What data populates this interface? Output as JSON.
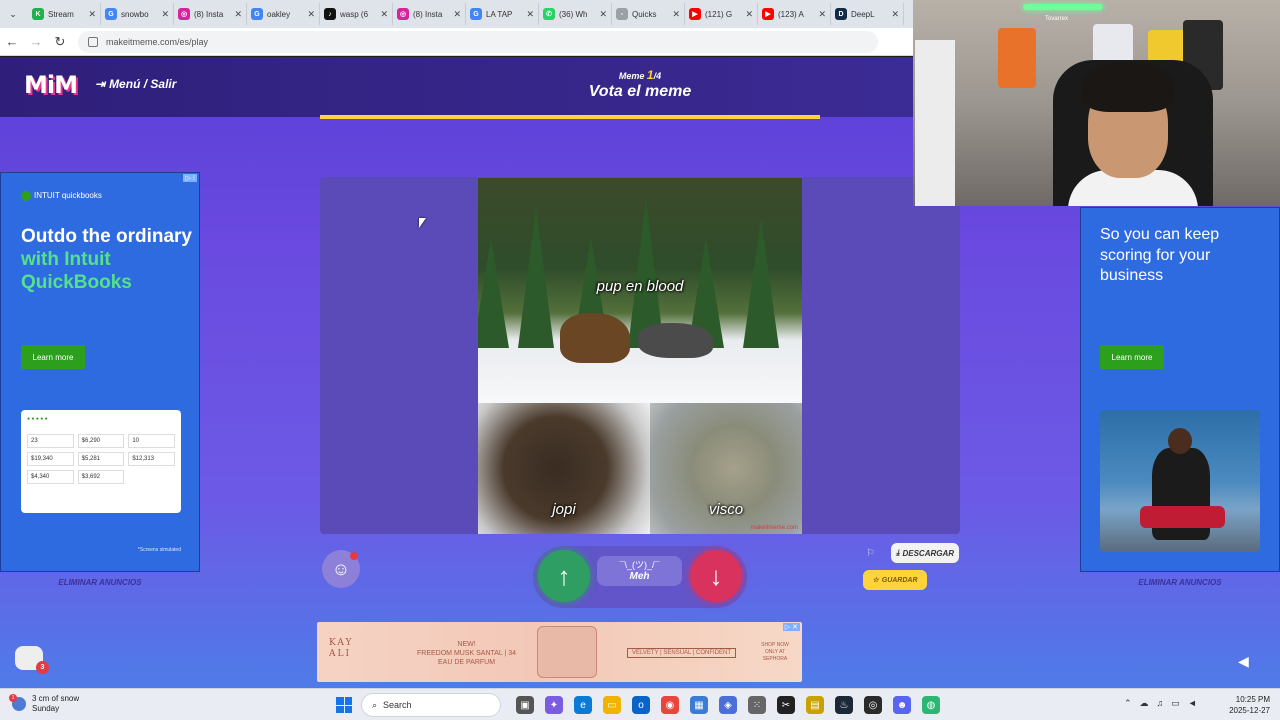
{
  "browser": {
    "tabs": [
      {
        "label": "Stream",
        "color": "#21b04b",
        "glyph": "K"
      },
      {
        "label": "snowbo",
        "color": "#4285f4",
        "glyph": "G"
      },
      {
        "label": "(8) Insta",
        "color": "#d6249f",
        "glyph": "◎"
      },
      {
        "label": "oakley",
        "color": "#4285f4",
        "glyph": "G"
      },
      {
        "label": "wasp (6",
        "color": "#111111",
        "glyph": "♪"
      },
      {
        "label": "(8) Insta",
        "color": "#d6249f",
        "glyph": "◎"
      },
      {
        "label": "LA TAP",
        "color": "#4285f4",
        "glyph": "G"
      },
      {
        "label": "(36) Wh",
        "color": "#25d366",
        "glyph": "✆"
      },
      {
        "label": "Quicks",
        "color": "#9aa0a6",
        "glyph": "▫"
      },
      {
        "label": "(121) G",
        "color": "#ff0000",
        "glyph": "▶"
      },
      {
        "label": "(123) A",
        "color": "#ff0000",
        "glyph": "▶"
      },
      {
        "label": "DeepL",
        "color": "#0f2b46",
        "glyph": "D"
      }
    ],
    "url": "makeitmeme.com/es/play"
  },
  "app": {
    "logo": "MiM",
    "menu_exit": "Menú / Salir",
    "meme_label": "Meme",
    "meme_current": "1",
    "meme_total": "/4",
    "title": "Vota el meme",
    "progress_fraction": 1.0
  },
  "meme": {
    "caption_top": "pup en blood",
    "caption_left": "jopi",
    "caption_right": "visco",
    "watermark": "makeitmeme.com"
  },
  "voting": {
    "up_label": "↑",
    "down_label": "↓",
    "meh_face": "¯\\_(ツ)_/¯",
    "meh_label": "Meh",
    "download_label": "DESCARGAR",
    "save_label": "GUARDAR"
  },
  "ads": {
    "left": {
      "brand": "INTUIT quickbooks",
      "headline_1": "Outdo the ordinary",
      "headline_2": "with Intuit QuickBooks",
      "cta": "Learn more",
      "note": "*Screens simulated",
      "shot_values": [
        "23",
        "$6,290",
        "10",
        "$19,340",
        "$5,281",
        "$12,313",
        "$4,340",
        "$3,692"
      ]
    },
    "right": {
      "headline": "So you can keep scoring for your business",
      "cta": "Learn more"
    },
    "remove_ads": "ELIMINAR ANUNCIOS",
    "bottom": {
      "brand": "KAY ALI",
      "line1": "NEW!",
      "line2": "FREEDOM MUSK SANTAL | 34",
      "line3": "EAU DE PARFUM",
      "tagline": "VELVETY | SENSUAL | CONFIDENT",
      "shop": "SHOP NOW ONLY AT SEPHORA"
    }
  },
  "chat": {
    "badge": "3"
  },
  "webcam": {
    "overlay_name": "Tovarrex"
  },
  "taskbar": {
    "weather_temp": "3 cm of snow",
    "weather_day": "Sunday",
    "weather_badge": "1",
    "search": "Search",
    "time": "10:25 PM",
    "date": "2025-12-27"
  }
}
